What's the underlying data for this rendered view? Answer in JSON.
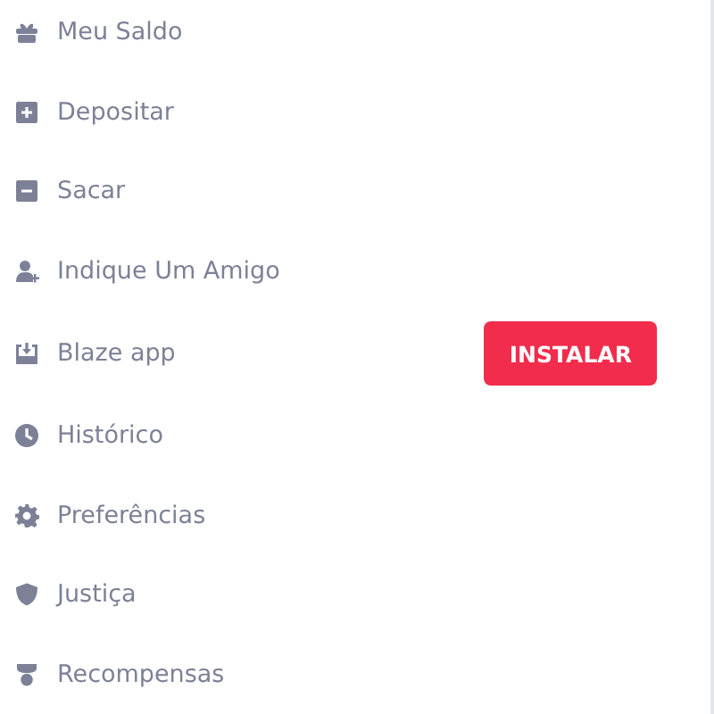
{
  "menu": {
    "items": [
      {
        "label": "Meu Saldo"
      },
      {
        "label": "Depositar"
      },
      {
        "label": "Sacar"
      },
      {
        "label": "Indique Um Amigo"
      },
      {
        "label": "Blaze app",
        "action": "INSTALAR"
      },
      {
        "label": "Histórico"
      },
      {
        "label": "Preferências"
      },
      {
        "label": "Justiça"
      },
      {
        "label": "Recompensas"
      }
    ]
  }
}
